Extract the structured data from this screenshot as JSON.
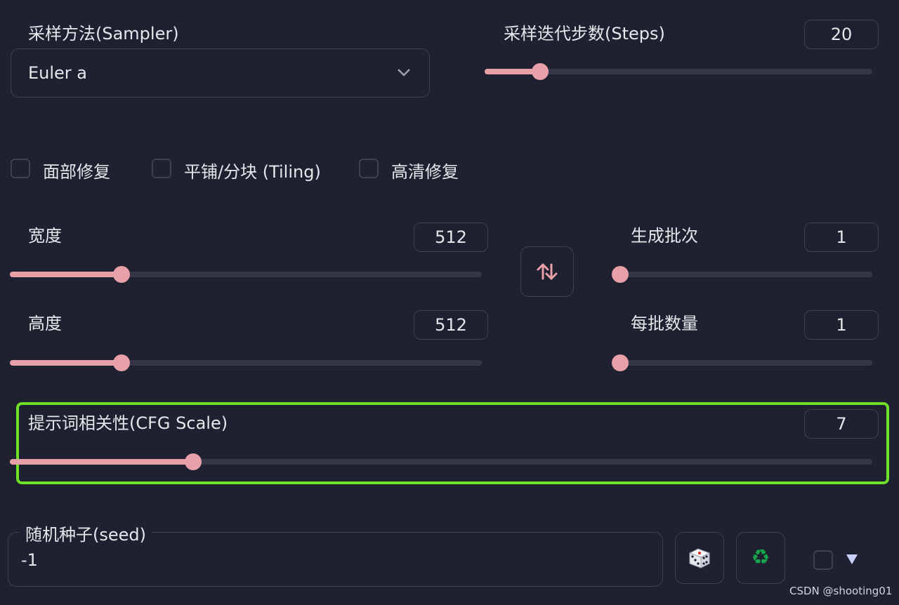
{
  "sampler": {
    "label": "采样方法(Sampler)",
    "value": "Euler a"
  },
  "steps": {
    "label": "采样迭代步数(Steps)",
    "value": "20",
    "min": 1,
    "max": 150
  },
  "checkboxes": [
    {
      "label": "面部修复",
      "checked": false
    },
    {
      "label": "平铺/分块 (Tiling)",
      "checked": false
    },
    {
      "label": "高清修复",
      "checked": false
    }
  ],
  "width": {
    "label": "宽度",
    "value": "512",
    "level": 0.24
  },
  "height": {
    "label": "高度",
    "value": "512",
    "level": 0.24
  },
  "swap_icon": "swap-vertical-icon",
  "batch_count": {
    "label": "生成批次",
    "value": "1",
    "level": 0.0
  },
  "batch_size": {
    "label": "每批数量",
    "value": "1",
    "level": 0.0
  },
  "cfg": {
    "label": "提示词相关性(CFG Scale)",
    "value": "7",
    "level": 0.21
  },
  "seed": {
    "label": "随机种子(seed)",
    "value": "-1"
  },
  "seed_buttons": {
    "random_icon": "dice-icon",
    "reuse_icon": "recycle-icon"
  },
  "watermark": "CSDN @shooting01",
  "colors": {
    "background": "#1f2030",
    "accent": "#e8a0a8",
    "highlight": "#6fe02a"
  }
}
